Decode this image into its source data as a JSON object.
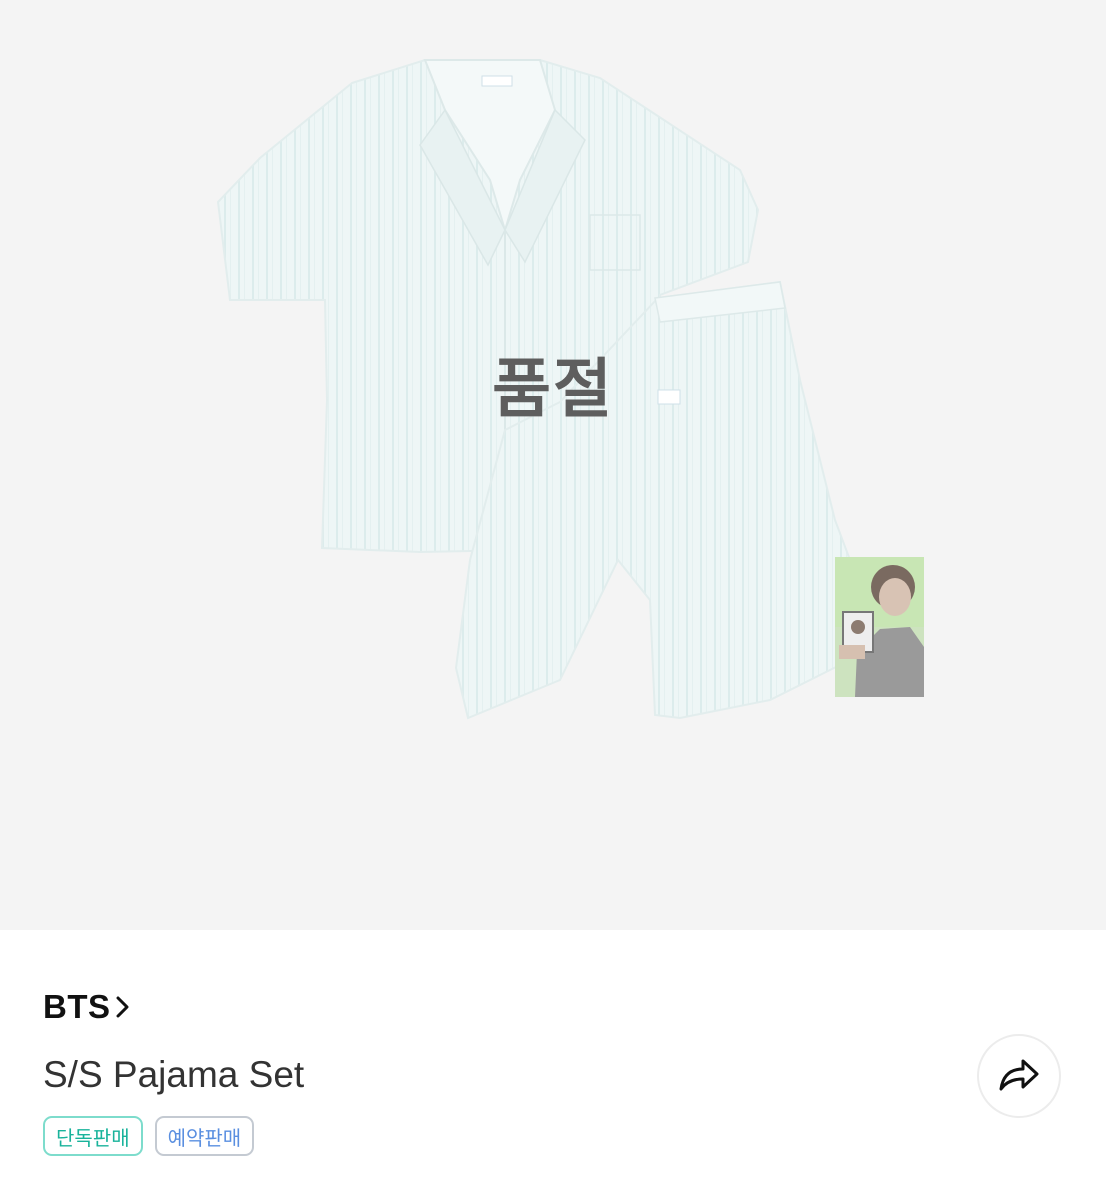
{
  "product_image": {
    "overlay_text": "품절"
  },
  "product": {
    "brand": "BTS",
    "title": "S/S Pajama Set"
  },
  "badges": [
    {
      "label": "단독판매"
    },
    {
      "label": "예약판매"
    }
  ],
  "icons": {
    "brand_link": "chevron-right-icon",
    "share": "share-arrow-icon"
  },
  "colors": {
    "hero_background": "#f4f4f4",
    "badge_exclusive": "#19b39b",
    "badge_preorder": "#5a8fe0"
  }
}
